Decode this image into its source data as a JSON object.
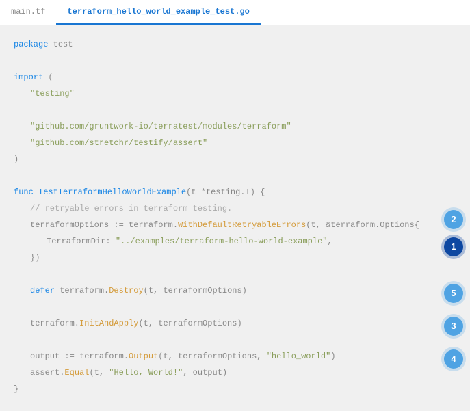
{
  "tabs": {
    "inactive": "main.tf",
    "active": "terraform_hello_world_example_test.go"
  },
  "code": {
    "l1_kw": "package",
    "l1_rest": " test",
    "l3_kw": "import",
    "l3_rest": " (",
    "l4_str": "\"testing\"",
    "l6_str": "\"github.com/gruntwork-io/terratest/modules/terraform\"",
    "l7_str": "\"github.com/stretchr/testify/assert\"",
    "l8": ")",
    "l10_kw": "func",
    "l10_fn": "TestTerraformHelloWorldExample",
    "l10_rest": "(t *testing.T) {",
    "l11_cmt": "// retryable errors in terraform testing.",
    "l12_a": "terraformOptions := terraform.",
    "l12_call": "WithDefaultRetryableErrors",
    "l12_b": "(t, &terraform.Options{",
    "l13_a": "TerraformDir: ",
    "l13_str": "\"../examples/terraform-hello-world-example\"",
    "l13_b": ",",
    "l14": "})",
    "l16_kw": "defer",
    "l16_a": " terraform.",
    "l16_call": "Destroy",
    "l16_b": "(t, terraformOptions)",
    "l18_a": "terraform.",
    "l18_call": "InitAndApply",
    "l18_b": "(t, terraformOptions)",
    "l20_a": "output := terraform.",
    "l20_call": "Output",
    "l20_b": "(t, terraformOptions, ",
    "l20_str": "\"hello_world\"",
    "l20_c": ")",
    "l21_a": "assert.",
    "l21_call": "Equal",
    "l21_b": "(t, ",
    "l21_str": "\"Hello, World!\"",
    "l21_c": ", output)",
    "l22": "}"
  },
  "steps": {
    "s1": "1",
    "s2": "2",
    "s3": "3",
    "s4": "4",
    "s5": "5"
  }
}
